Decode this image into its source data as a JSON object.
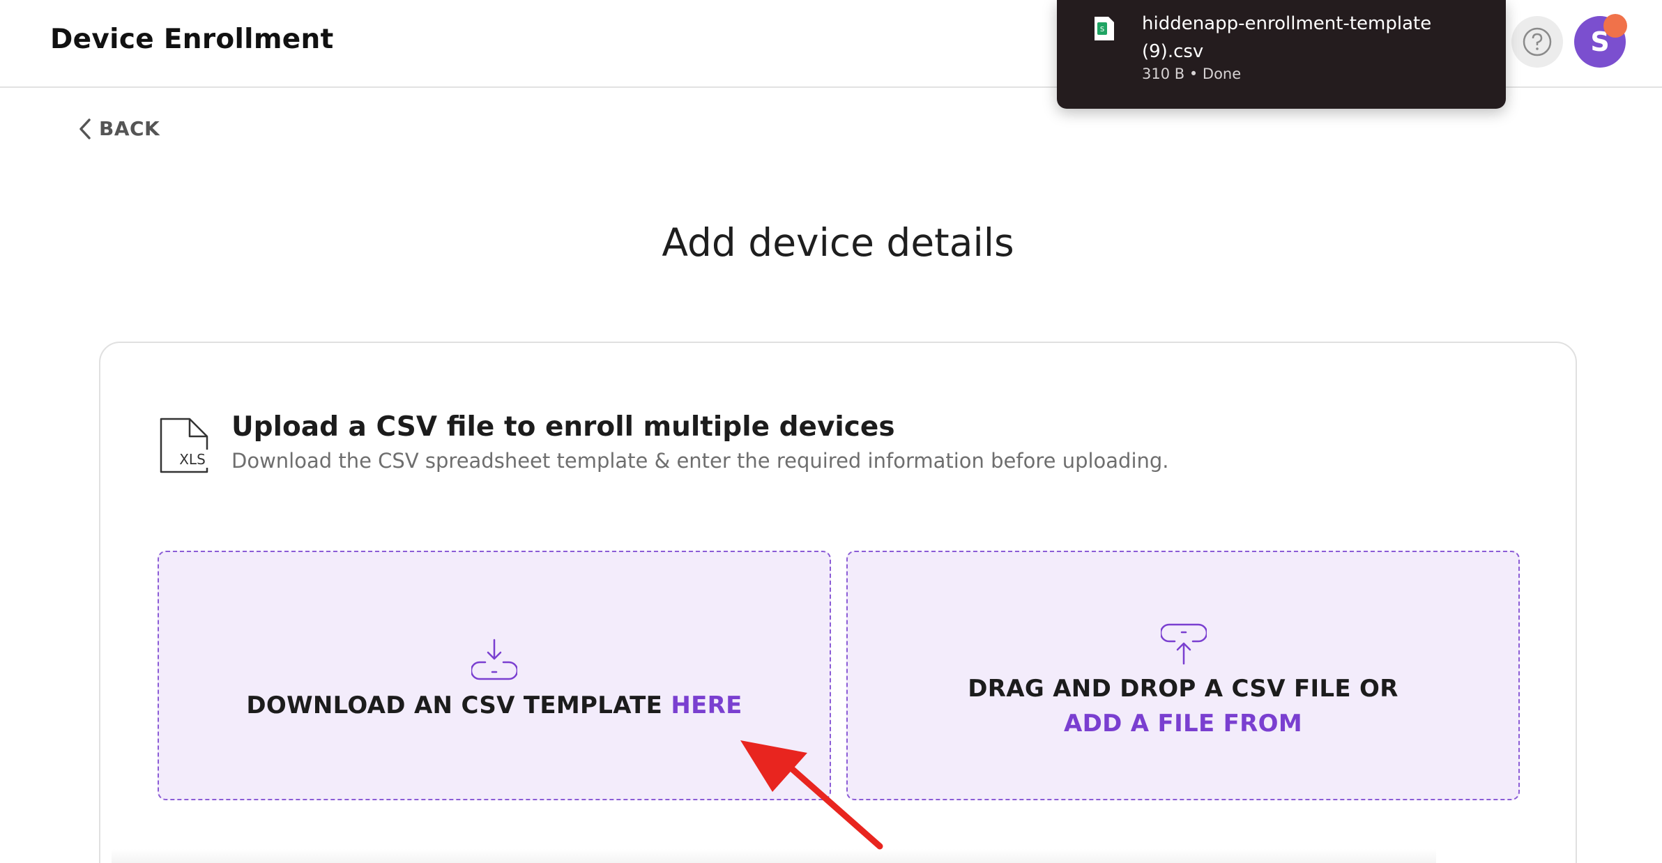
{
  "header": {
    "title": "Device Enrollment",
    "help_icon": "question-circle-icon",
    "avatar_initial": "S",
    "avatar_color": "#7b4fcf",
    "notification_dot_color": "#f0724a"
  },
  "download_popup": {
    "file_name_line1": "hiddenapp-enrollment-template",
    "file_name_line2": "(9).csv",
    "meta": "310 B • Done",
    "file_icon": "spreadsheet-file-icon"
  },
  "nav": {
    "back_label": "BACK"
  },
  "page": {
    "title": "Add device details"
  },
  "card": {
    "icon_label": "XLS",
    "heading": "Upload a CSV file to enroll multiple devices",
    "subtext": "Download the CSV spreadsheet template & enter the required information before uploading.",
    "download_zone": {
      "text": "DOWNLOAD AN CSV TEMPLATE ",
      "link": "HERE",
      "icon": "download-tray-icon"
    },
    "upload_zone": {
      "line1": "DRAG AND DROP A CSV FILE OR",
      "link": "ADD A FILE FROM",
      "icon": "upload-tray-icon"
    }
  },
  "colors": {
    "accent": "#7a3fd0",
    "zone_background": "#f3ecfb",
    "annotation_arrow": "#e8251f"
  }
}
